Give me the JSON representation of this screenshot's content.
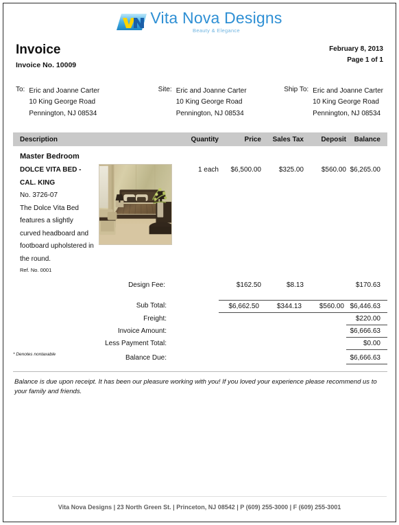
{
  "brand": {
    "logo_icon": "vn-monogram-icon",
    "company_name": "Vita Nova Designs",
    "tagline": "Beauty & Elegance",
    "logo_colors": {
      "badge_start": "#9fdcf5",
      "badge_end": "#2a9fdc",
      "letter_v": "#ffd400",
      "letter_n": "#1b5fa8",
      "title": "#2e8fd4",
      "tagline": "#6fb4e0"
    }
  },
  "header": {
    "title": "Invoice",
    "invoice_no_label": "Invoice No. 10009",
    "date": "February 8, 2013",
    "page": "Page 1 of 1"
  },
  "addresses": [
    {
      "label": "To:",
      "lines": [
        "Eric and Joanne Carter",
        "10 King George Road",
        "Pennington, NJ  08534"
      ]
    },
    {
      "label": "Site:",
      "lines": [
        "Eric and Joanne Carter",
        "10 King George Road",
        "Pennington, NJ  08534"
      ]
    },
    {
      "label": "Ship To:",
      "lines": [
        "Eric and Joanne Carter",
        "10 King George Road",
        "Pennington, NJ  08534"
      ]
    }
  ],
  "table": {
    "columns": [
      "Description",
      "Quantity",
      "Price",
      "Sales Tax",
      "Deposit",
      "Balance"
    ],
    "room": "Master Bedroom",
    "line_item": {
      "product_name": "DOLCE VITA BED - CAL. KING",
      "product_number": "No. 3726-07",
      "description": "The Dolce Vita Bed features a slightly curved headboard and footboard upholstered in the round.",
      "ref_no": "Ref. No. 0001",
      "image_alt": "bedroom-photo",
      "quantity": "1 each",
      "price": "$6,500.00",
      "sales_tax": "$325.00",
      "deposit": "$560.00",
      "balance": "$6,265.00"
    },
    "design_fee": {
      "label": "Design Fee:",
      "quantity": "",
      "price": "$162.50",
      "sales_tax": "$8.13",
      "deposit": "",
      "balance": "$170.63"
    }
  },
  "totals": {
    "sub_total": {
      "label": "Sub Total:",
      "price": "$6,662.50",
      "sales_tax": "$344.13",
      "deposit": "$560.00",
      "balance": "$6,446.63"
    },
    "freight": {
      "label": "Freight:",
      "balance": "$220.00"
    },
    "invoice_amount": {
      "label": "Invoice Amount:",
      "balance": "$6,666.63"
    },
    "less_payment_total": {
      "label": "Less Payment Total:",
      "balance": "$0.00"
    },
    "balance_due": {
      "label": "Balance Due:",
      "balance": "$6,666.63"
    }
  },
  "notes": {
    "nontaxable": "* Denotes nontaxable",
    "disclaimer": "Balance is due upon receipt.  It has been our pleasure working with you!  If you loved your experience please recommend us to your family and friends."
  },
  "footer": {
    "text": "Vita Nova Designs | 23 North Green St. | Princeton, NJ  08542 | P (609) 255-3000 | F (609) 255-3001"
  }
}
